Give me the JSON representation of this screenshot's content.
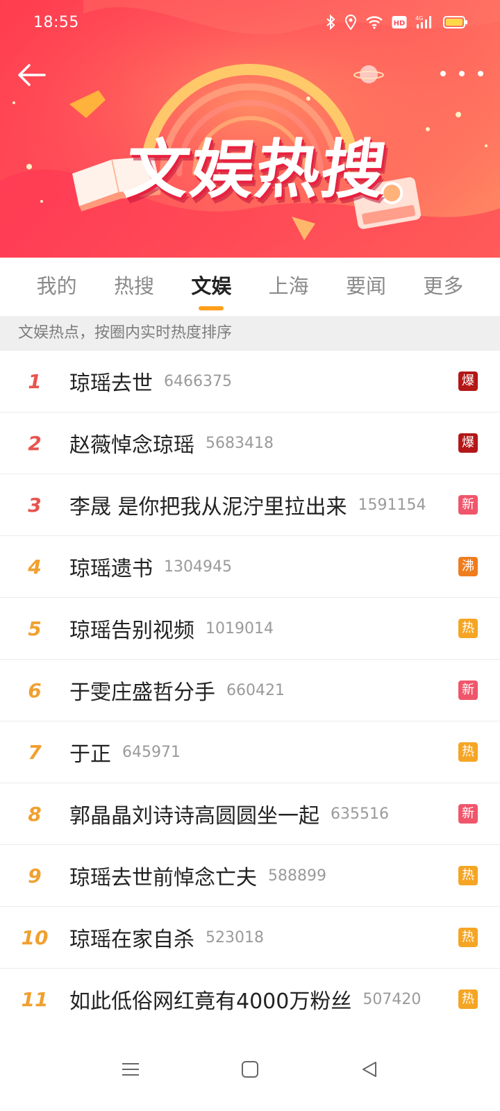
{
  "status_bar": {
    "time": "18:55",
    "icons": [
      "bluetooth-icon",
      "location-icon",
      "wifi-icon",
      "hd-icon",
      "signal-4g-icon",
      "battery-icon"
    ],
    "hd_label": "HD",
    "net_label": "4G"
  },
  "banner": {
    "title": "文娱热搜",
    "back_icon": "back-arrow-icon",
    "more_icon": "more-dots-icon",
    "colors": {
      "start": "#ff3d4f",
      "end": "#ff8a63",
      "accent": "#ffd36b"
    }
  },
  "tabs": [
    {
      "label": "我的",
      "active": false
    },
    {
      "label": "热搜",
      "active": false
    },
    {
      "label": "文娱",
      "active": true
    },
    {
      "label": "上海",
      "active": false
    },
    {
      "label": "要闻",
      "active": false
    },
    {
      "label": "更多",
      "active": false
    }
  ],
  "subheader": "文娱热点，按圈内实时热度排序",
  "colors": {
    "rank_top": "#e8544e",
    "rank_other": "#f0a030",
    "badge_bao": "#b31717",
    "badge_xin": "#f0566b",
    "badge_fei": "#ef7d1e",
    "badge_re": "#f5a524",
    "tab_indicator": "#ff9f1c"
  },
  "items": [
    {
      "rank": "1",
      "title": "琼瑶去世",
      "count": "6466375",
      "badge": "爆"
    },
    {
      "rank": "2",
      "title": "赵薇悼念琼瑶",
      "count": "5683418",
      "badge": "爆"
    },
    {
      "rank": "3",
      "title": "李晟 是你把我从泥泞里拉出来",
      "count": "1591154",
      "badge": "新"
    },
    {
      "rank": "4",
      "title": "琼瑶遗书",
      "count": "1304945",
      "badge": "沸"
    },
    {
      "rank": "5",
      "title": "琼瑶告别视频",
      "count": "1019014",
      "badge": "热"
    },
    {
      "rank": "6",
      "title": "于雯庄盛哲分手",
      "count": "660421",
      "badge": "新"
    },
    {
      "rank": "7",
      "title": "于正",
      "count": "645971",
      "badge": "热"
    },
    {
      "rank": "8",
      "title": "郭晶晶刘诗诗高圆圆坐一起",
      "count": "635516",
      "badge": "新"
    },
    {
      "rank": "9",
      "title": "琼瑶去世前悼念亡夫",
      "count": "588899",
      "badge": "热"
    },
    {
      "rank": "10",
      "title": "琼瑶在家自杀",
      "count": "523018",
      "badge": "热"
    },
    {
      "rank": "11",
      "title": "如此低俗网红竟有4000万粉丝",
      "count": "507420",
      "badge": "热"
    }
  ],
  "nav": {
    "icons": [
      "menu-icon",
      "home-square-icon",
      "back-triangle-icon"
    ]
  }
}
